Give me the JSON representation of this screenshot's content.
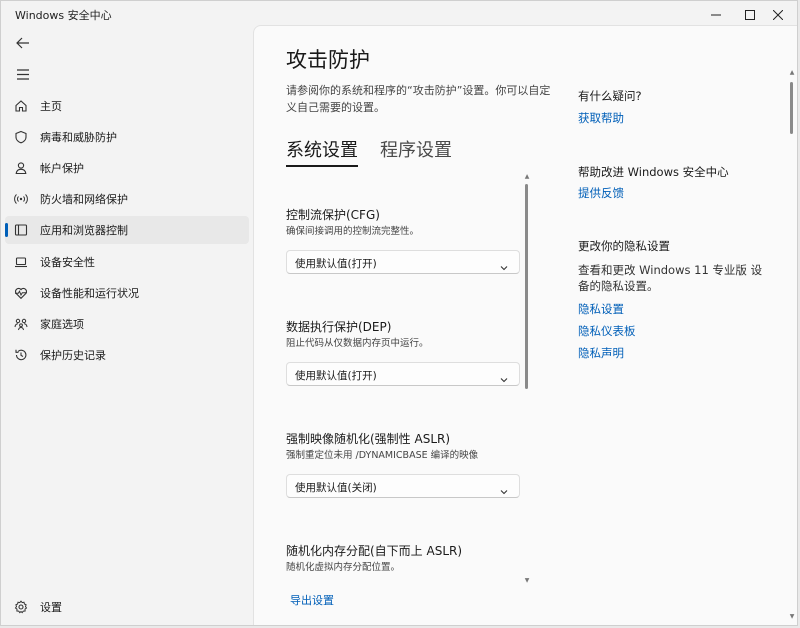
{
  "window": {
    "title": "Windows 安全中心",
    "minimize": "—",
    "maximize": "☐",
    "close": "✕"
  },
  "nav": {
    "back_icon": "back-arrow-icon",
    "menu_icon": "hamburger-menu-icon",
    "items": [
      {
        "label": "主页",
        "icon": "home-icon"
      },
      {
        "label": "病毒和威胁防护",
        "icon": "shield-icon"
      },
      {
        "label": "帐户保护",
        "icon": "person-icon"
      },
      {
        "label": "防火墙和网络保护",
        "icon": "wifi-antenna-icon"
      },
      {
        "label": "应用和浏览器控制",
        "icon": "app-window-icon"
      },
      {
        "label": "设备安全性",
        "icon": "laptop-icon"
      },
      {
        "label": "设备性能和运行状况",
        "icon": "heart-pulse-icon"
      },
      {
        "label": "家庭选项",
        "icon": "family-icon"
      },
      {
        "label": "保护历史记录",
        "icon": "history-icon"
      }
    ],
    "active_index": 4,
    "settings_label": "设置",
    "accent": "#005fb8"
  },
  "main": {
    "title": "攻击防护",
    "description": "请参阅你的系统和程序的“攻击防护”设置。你可以自定义自己需要的设置。",
    "tabs": [
      {
        "label": "系统设置",
        "active": true
      },
      {
        "label": "程序设置",
        "active": false
      }
    ],
    "settings": [
      {
        "title": "控制流保护(CFG)",
        "desc": "确保间接调用的控制流完整性。",
        "value": "使用默认值(打开)"
      },
      {
        "title": "数据执行保护(DEP)",
        "desc": "阻止代码从仅数据内存页中运行。",
        "value": "使用默认值(打开)"
      },
      {
        "title": "强制映像随机化(强制性 ASLR)",
        "desc": "强制重定位未用 /DYNAMICBASE 编译的映像",
        "value": "使用默认值(关闭)"
      },
      {
        "title": "随机化内存分配(自下而上 ASLR)",
        "desc": "随机化虚拟内存分配位置。"
      }
    ],
    "export_label": "导出设置"
  },
  "aside": {
    "question_heading": "有什么疑问?",
    "help_link": "获取帮助",
    "improve_heading": "帮助改进 Windows 安全中心",
    "feedback_link": "提供反馈",
    "privacy_heading": "更改你的隐私设置",
    "privacy_text": "查看和更改 Windows 11 专业版 设备的隐私设置。",
    "privacy_links": [
      "隐私设置",
      "隐私仪表板",
      "隐私声明"
    ]
  }
}
